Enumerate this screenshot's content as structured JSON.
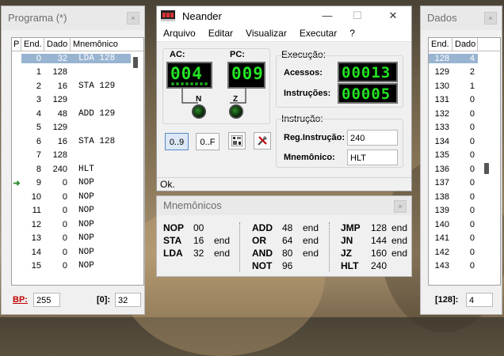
{
  "programa": {
    "title": "Programa  (*)",
    "close_glyph": "×",
    "columns": [
      "P",
      "End.",
      "Dado",
      "Mnemônico"
    ],
    "rows": [
      {
        "p": "",
        "end": "0",
        "dado": "32",
        "mnem": "LDA 128",
        "selected": true
      },
      {
        "p": "",
        "end": "1",
        "dado": "128",
        "mnem": ""
      },
      {
        "p": "",
        "end": "2",
        "dado": "16",
        "mnem": "STA 129"
      },
      {
        "p": "",
        "end": "3",
        "dado": "129",
        "mnem": ""
      },
      {
        "p": "",
        "end": "4",
        "dado": "48",
        "mnem": "ADD 129"
      },
      {
        "p": "",
        "end": "5",
        "dado": "129",
        "mnem": ""
      },
      {
        "p": "",
        "end": "6",
        "dado": "16",
        "mnem": "STA 128"
      },
      {
        "p": "",
        "end": "7",
        "dado": "128",
        "mnem": ""
      },
      {
        "p": "",
        "end": "8",
        "dado": "240",
        "mnem": "HLT"
      },
      {
        "p": "➜",
        "end": "9",
        "dado": "0",
        "mnem": "NOP"
      },
      {
        "p": "",
        "end": "10",
        "dado": "0",
        "mnem": "NOP"
      },
      {
        "p": "",
        "end": "11",
        "dado": "0",
        "mnem": "NOP"
      },
      {
        "p": "",
        "end": "12",
        "dado": "0",
        "mnem": "NOP"
      },
      {
        "p": "",
        "end": "13",
        "dado": "0",
        "mnem": "NOP"
      },
      {
        "p": "",
        "end": "14",
        "dado": "0",
        "mnem": "NOP"
      },
      {
        "p": "",
        "end": "15",
        "dado": "0",
        "mnem": "NOP"
      }
    ],
    "bp_label": "BP:",
    "bp_value": "255",
    "addr_label": "[0]:",
    "addr_value": "32"
  },
  "dados": {
    "title": "Dados",
    "close_glyph": "×",
    "columns": [
      "End.",
      "Dado"
    ],
    "rows": [
      {
        "end": "128",
        "dado": "4",
        "selected": true
      },
      {
        "end": "129",
        "dado": "2"
      },
      {
        "end": "130",
        "dado": "1"
      },
      {
        "end": "131",
        "dado": "0"
      },
      {
        "end": "132",
        "dado": "0"
      },
      {
        "end": "133",
        "dado": "0"
      },
      {
        "end": "134",
        "dado": "0"
      },
      {
        "end": "135",
        "dado": "0"
      },
      {
        "end": "136",
        "dado": "0"
      },
      {
        "end": "137",
        "dado": "0"
      },
      {
        "end": "138",
        "dado": "0"
      },
      {
        "end": "139",
        "dado": "0"
      },
      {
        "end": "140",
        "dado": "0"
      },
      {
        "end": "141",
        "dado": "0"
      },
      {
        "end": "142",
        "dado": "0"
      },
      {
        "end": "143",
        "dado": "0"
      }
    ],
    "addr_label": "[128]:",
    "addr_value": "4"
  },
  "neander": {
    "title": "Neander",
    "min_glyph": "—",
    "max_glyph": "☐",
    "close_glyph": "✕",
    "menu": [
      "Arquivo",
      "Editar",
      "Visualizar",
      "Executar",
      "?"
    ],
    "ac_label": "AC:",
    "ac_value": "004",
    "pc_label": "PC:",
    "pc_value": "009",
    "n_label": "N",
    "z_label": "Z",
    "execucao_label": "Execução:",
    "acessos_label": "Acessos:",
    "acessos_value": "00013",
    "instrucoes_label": "Instruções:",
    "instrucoes_value": "00005",
    "instrucao_label": "Instrução:",
    "reg_label": "Reg.Instrução:",
    "reg_value": "240",
    "mnem_label": "Mnemônico:",
    "mnem_value": "HLT",
    "btn_dec": "0..9",
    "btn_hex": "0..F",
    "status": "Ok."
  },
  "mnemonicos": {
    "title": "Mnemônicos",
    "close_glyph": "×",
    "col1": [
      {
        "op": "NOP",
        "code": "00",
        "arg": ""
      },
      {
        "op": "STA",
        "code": "16",
        "arg": "end"
      },
      {
        "op": "LDA",
        "code": "32",
        "arg": "end"
      }
    ],
    "col2": [
      {
        "op": "ADD",
        "code": "48",
        "arg": "end"
      },
      {
        "op": "OR",
        "code": "64",
        "arg": "end"
      },
      {
        "op": "AND",
        "code": "80",
        "arg": "end"
      },
      {
        "op": "NOT",
        "code": "96",
        "arg": ""
      }
    ],
    "col3": [
      {
        "op": "JMP",
        "code": "128",
        "arg": "end"
      },
      {
        "op": "JN",
        "code": "144",
        "arg": "end"
      },
      {
        "op": "JZ",
        "code": "160",
        "arg": "end"
      },
      {
        "op": "HLT",
        "code": "240",
        "arg": ""
      }
    ]
  }
}
